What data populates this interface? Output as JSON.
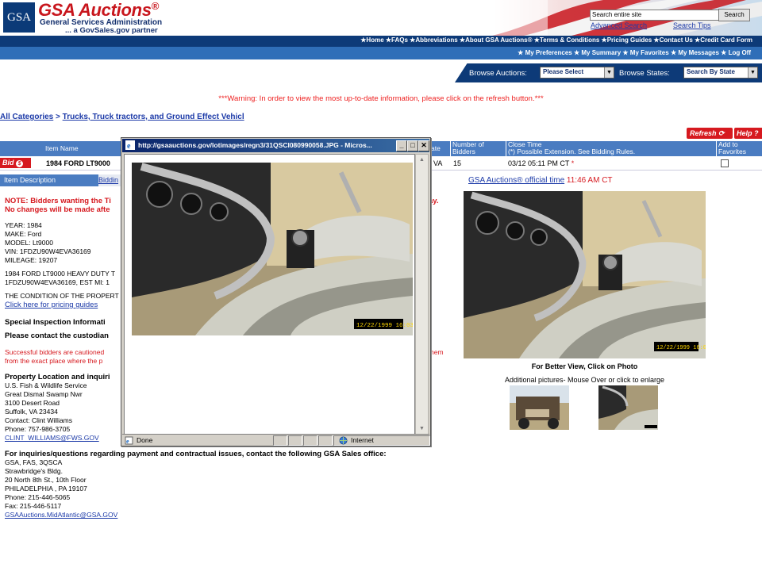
{
  "header": {
    "logo": "GSA",
    "brand": "GSA Auctions",
    "brand_reg": "®",
    "sub1": "General Services Administration",
    "sub2": "... a GovSales.gov partner",
    "search_placeholder": "Search entire site",
    "search_button": "Search",
    "advanced_search": "Advanced Search",
    "search_tips": "Search Tips"
  },
  "nav_primary": [
    "Home",
    "FAQs",
    "Abbreviations",
    "About GSA Auctions®",
    "Terms & Conditions",
    "Pricing Guides",
    "Contact Us",
    "Credit Card Form"
  ],
  "nav_secondary": [
    "My Preferences",
    "My Summary",
    "My Favorites",
    "My Messages",
    "Log Off"
  ],
  "browse": {
    "auctions_label": "Browse Auctions:",
    "auctions_value": "Please Select",
    "states_label": "Browse States:",
    "states_value": "Search By State"
  },
  "warning": "***Warning: In order to view the most up-to-date information, please click on the refresh button.***",
  "breadcrumb": {
    "all": "All Categories",
    "sep": " > ",
    "category": "Trucks, Truck tractors, and Ground Effect Vehicl"
  },
  "buttons": {
    "refresh": "Refresh",
    "help": "Help",
    "bid": "Bid"
  },
  "table": {
    "headers": {
      "item_name": "Item Name",
      "state": "ate",
      "bidders": "Number of Bidders",
      "close_time": "Close Time",
      "close_time_note": "(*) Possible Extension. See Bidding Rules.",
      "favorites": "Add to Favorites"
    },
    "row": {
      "item_name": "1984 FORD LT9000",
      "state": "VA",
      "bidders": "15",
      "close_time": "03/12 05:11 PM CT",
      "close_mark": "*"
    }
  },
  "tabs": {
    "description": "Item Description",
    "bidding": "Biddin"
  },
  "official_time": {
    "label": "GSA Auctions® official time",
    "time": "11:46 AM CT"
  },
  "content": {
    "note1": "NOTE: Bidders wanting the Ti",
    "note1_tail": "ay.",
    "note2": "No changes will be made afte",
    "specs": [
      "YEAR: 1984",
      "MAKE: Ford",
      "MODEL: Lt9000",
      "VIN: 1FDZU90W4EVA36169",
      "MILEAGE: 19207"
    ],
    "desc1": "1984 FORD LT9000 HEAVY DUTY T",
    "desc2": "1FDZU90W4EVA36169, EST MI: 1",
    "condition": "THE CONDITION OF THE PROPERT",
    "pricing_link": "Click here for pricing guides",
    "special_heading": "Special Inspection Informati",
    "custodian": "Please contact the custodian",
    "cautioned1": "Successful bidders are cautioned",
    "cautioned1_tail": "hem",
    "cautioned2": "from the exact place where the p",
    "location_heading": "Property Location and inquiri",
    "location": [
      "U.S. Fish & Wildlife Service",
      "Great Dismal Swamp Nwr",
      "3100 Desert Road",
      "Suffolk, VA  23434",
      "Contact: Clint Williams",
      "Phone: 757-986-3705"
    ],
    "contact_email": "CLINT_WILLIAMS@FWS.GOV",
    "sales_heading": "For inquiries/questions regarding payment and contractual issues, contact the following GSA Sales office:",
    "sales_office": [
      "GSA, FAS, 3QSCA",
      "Strawbridge's Bldg.",
      "20 North 8th St., 10th Floor",
      "PHILADELPHIA ,  PA  19107",
      "Phone: 215-446-5065",
      "Fax: 215-446-5117"
    ],
    "sales_email": "GSAAuctions.MidAtlantic@GSA.GOV"
  },
  "photos": {
    "better_view": "For Better View, Click on Photo",
    "additional": "Additional pictures- Mouse Over or click to enlarge",
    "timestamp": "12/22/1999 16:03"
  },
  "popup": {
    "title": "http://gsaauctions.gov/lotimages/regn3/31QSCI080990058.JPG - Micros...",
    "status": "Done",
    "zone": "Internet"
  }
}
